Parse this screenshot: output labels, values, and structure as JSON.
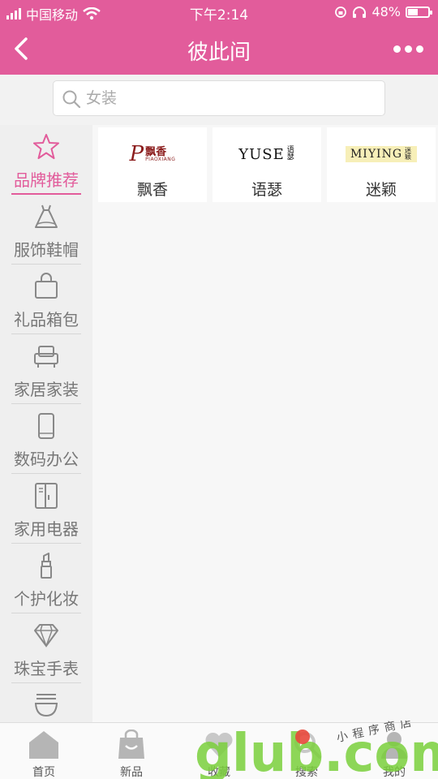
{
  "status": {
    "carrier": "中国移动",
    "time": "下午2:14",
    "battery": "48%",
    "battery_level": 0.48
  },
  "nav": {
    "title": "彼此间"
  },
  "search": {
    "placeholder": "女装"
  },
  "sidebar": {
    "items": [
      {
        "label": "品牌推荐",
        "icon": "star-icon",
        "active": true
      },
      {
        "label": "服饰鞋帽",
        "icon": "dress-icon",
        "active": false
      },
      {
        "label": "礼品箱包",
        "icon": "bag-icon",
        "active": false
      },
      {
        "label": "家居家装",
        "icon": "sofa-icon",
        "active": false
      },
      {
        "label": "数码办公",
        "icon": "phone-icon",
        "active": false
      },
      {
        "label": "家用电器",
        "icon": "fridge-icon",
        "active": false
      },
      {
        "label": "个护化妆",
        "icon": "lipstick-icon",
        "active": false
      },
      {
        "label": "珠宝手表",
        "icon": "diamond-icon",
        "active": false
      },
      {
        "label": "",
        "icon": "bowl-icon",
        "active": false
      }
    ]
  },
  "brands": [
    {
      "name": "飘香",
      "logo_main": "飘香",
      "logo_sub": "PIAOXIANG",
      "logo_color": "#8b1c1c"
    },
    {
      "name": "语瑟",
      "logo_main": "YUSE",
      "logo_sub": "语瑟",
      "logo_color": "#111111"
    },
    {
      "name": "迷颖",
      "logo_main": "MIYING",
      "logo_sub": "迷颖",
      "logo_color": "#222222"
    }
  ],
  "tabbar": {
    "items": [
      {
        "label": "首页",
        "icon": "home-icon"
      },
      {
        "label": "新品",
        "icon": "shopping-bag-icon"
      },
      {
        "label": "收藏",
        "icon": "favorite-icon"
      },
      {
        "label": "搜索",
        "icon": "search-icon"
      },
      {
        "label": "我的",
        "icon": "user-icon"
      }
    ]
  },
  "watermark": {
    "text": "glub.com",
    "tagline": "小程序商店"
  },
  "colors": {
    "accent": "#e25c9b",
    "sidebar_bg": "#efefef",
    "watermark_green": "#7bd03c",
    "watermark_blue": "#3fb6e8"
  }
}
